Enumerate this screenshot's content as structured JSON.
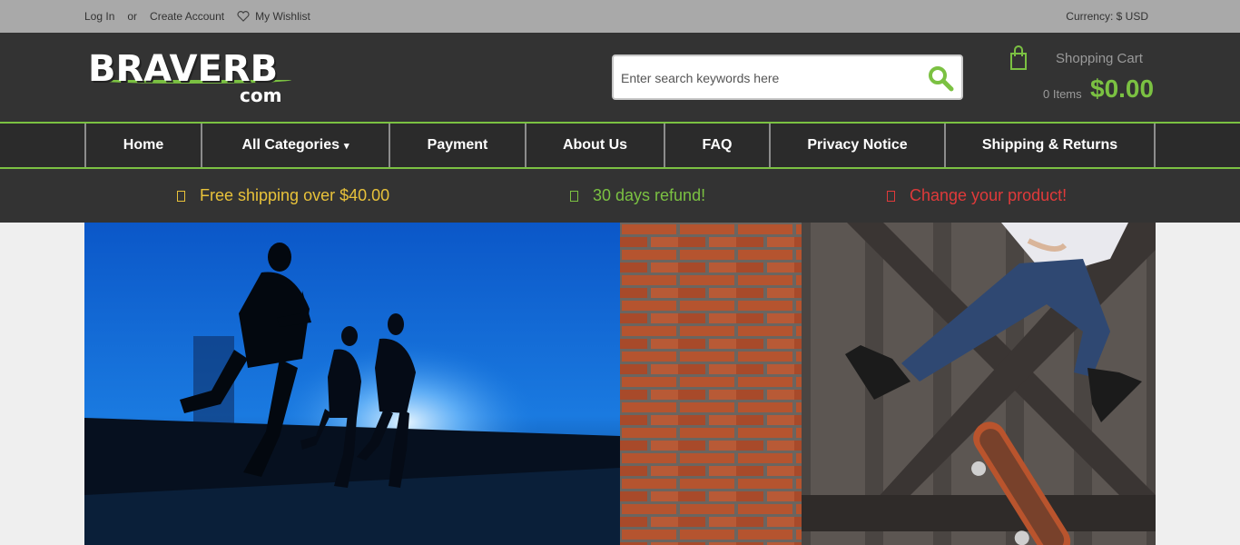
{
  "topbar": {
    "login": "Log In",
    "or": "or",
    "create_account": "Create Account",
    "wishlist": "My Wishlist",
    "currency": "Currency: $ USD"
  },
  "logo": {
    "brand": "BRAVERB",
    "suffix": "com"
  },
  "search": {
    "placeholder": "Enter search keywords here"
  },
  "cart": {
    "title": "Shopping Cart",
    "items": "0 Items",
    "total": "$0.00"
  },
  "nav": {
    "items": [
      {
        "label": "Home"
      },
      {
        "label": "All Categories"
      },
      {
        "label": "Payment"
      },
      {
        "label": "About Us"
      },
      {
        "label": "FAQ"
      },
      {
        "label": "Privacy Notice"
      },
      {
        "label": "Shipping & Returns"
      }
    ],
    "caret": "▾"
  },
  "promo": {
    "items": [
      {
        "text": "Free shipping over $40.00",
        "color": "#e8c23a"
      },
      {
        "text": "30 days refund!",
        "color": "#7bc142"
      },
      {
        "text": "Change your product!",
        "color": "#e03a3a"
      }
    ]
  },
  "colors": {
    "accent": "#7bc142",
    "header_bg": "#333333",
    "topbar_bg": "#a9a9a9"
  }
}
